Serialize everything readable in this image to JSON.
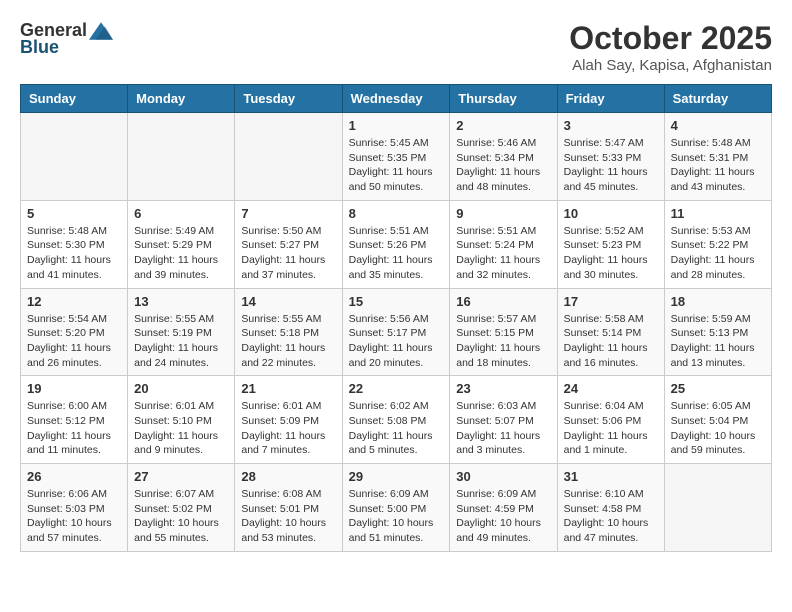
{
  "logo": {
    "general": "General",
    "blue": "Blue"
  },
  "title": "October 2025",
  "subtitle": "Alah Say, Kapisa, Afghanistan",
  "days_of_week": [
    "Sunday",
    "Monday",
    "Tuesday",
    "Wednesday",
    "Thursday",
    "Friday",
    "Saturday"
  ],
  "weeks": [
    [
      {
        "day": "",
        "sunrise": "",
        "sunset": "",
        "daylight": ""
      },
      {
        "day": "",
        "sunrise": "",
        "sunset": "",
        "daylight": ""
      },
      {
        "day": "",
        "sunrise": "",
        "sunset": "",
        "daylight": ""
      },
      {
        "day": "1",
        "sunrise": "Sunrise: 5:45 AM",
        "sunset": "Sunset: 5:35 PM",
        "daylight": "Daylight: 11 hours and 50 minutes."
      },
      {
        "day": "2",
        "sunrise": "Sunrise: 5:46 AM",
        "sunset": "Sunset: 5:34 PM",
        "daylight": "Daylight: 11 hours and 48 minutes."
      },
      {
        "day": "3",
        "sunrise": "Sunrise: 5:47 AM",
        "sunset": "Sunset: 5:33 PM",
        "daylight": "Daylight: 11 hours and 45 minutes."
      },
      {
        "day": "4",
        "sunrise": "Sunrise: 5:48 AM",
        "sunset": "Sunset: 5:31 PM",
        "daylight": "Daylight: 11 hours and 43 minutes."
      }
    ],
    [
      {
        "day": "5",
        "sunrise": "Sunrise: 5:48 AM",
        "sunset": "Sunset: 5:30 PM",
        "daylight": "Daylight: 11 hours and 41 minutes."
      },
      {
        "day": "6",
        "sunrise": "Sunrise: 5:49 AM",
        "sunset": "Sunset: 5:29 PM",
        "daylight": "Daylight: 11 hours and 39 minutes."
      },
      {
        "day": "7",
        "sunrise": "Sunrise: 5:50 AM",
        "sunset": "Sunset: 5:27 PM",
        "daylight": "Daylight: 11 hours and 37 minutes."
      },
      {
        "day": "8",
        "sunrise": "Sunrise: 5:51 AM",
        "sunset": "Sunset: 5:26 PM",
        "daylight": "Daylight: 11 hours and 35 minutes."
      },
      {
        "day": "9",
        "sunrise": "Sunrise: 5:51 AM",
        "sunset": "Sunset: 5:24 PM",
        "daylight": "Daylight: 11 hours and 32 minutes."
      },
      {
        "day": "10",
        "sunrise": "Sunrise: 5:52 AM",
        "sunset": "Sunset: 5:23 PM",
        "daylight": "Daylight: 11 hours and 30 minutes."
      },
      {
        "day": "11",
        "sunrise": "Sunrise: 5:53 AM",
        "sunset": "Sunset: 5:22 PM",
        "daylight": "Daylight: 11 hours and 28 minutes."
      }
    ],
    [
      {
        "day": "12",
        "sunrise": "Sunrise: 5:54 AM",
        "sunset": "Sunset: 5:20 PM",
        "daylight": "Daylight: 11 hours and 26 minutes."
      },
      {
        "day": "13",
        "sunrise": "Sunrise: 5:55 AM",
        "sunset": "Sunset: 5:19 PM",
        "daylight": "Daylight: 11 hours and 24 minutes."
      },
      {
        "day": "14",
        "sunrise": "Sunrise: 5:55 AM",
        "sunset": "Sunset: 5:18 PM",
        "daylight": "Daylight: 11 hours and 22 minutes."
      },
      {
        "day": "15",
        "sunrise": "Sunrise: 5:56 AM",
        "sunset": "Sunset: 5:17 PM",
        "daylight": "Daylight: 11 hours and 20 minutes."
      },
      {
        "day": "16",
        "sunrise": "Sunrise: 5:57 AM",
        "sunset": "Sunset: 5:15 PM",
        "daylight": "Daylight: 11 hours and 18 minutes."
      },
      {
        "day": "17",
        "sunrise": "Sunrise: 5:58 AM",
        "sunset": "Sunset: 5:14 PM",
        "daylight": "Daylight: 11 hours and 16 minutes."
      },
      {
        "day": "18",
        "sunrise": "Sunrise: 5:59 AM",
        "sunset": "Sunset: 5:13 PM",
        "daylight": "Daylight: 11 hours and 13 minutes."
      }
    ],
    [
      {
        "day": "19",
        "sunrise": "Sunrise: 6:00 AM",
        "sunset": "Sunset: 5:12 PM",
        "daylight": "Daylight: 11 hours and 11 minutes."
      },
      {
        "day": "20",
        "sunrise": "Sunrise: 6:01 AM",
        "sunset": "Sunset: 5:10 PM",
        "daylight": "Daylight: 11 hours and 9 minutes."
      },
      {
        "day": "21",
        "sunrise": "Sunrise: 6:01 AM",
        "sunset": "Sunset: 5:09 PM",
        "daylight": "Daylight: 11 hours and 7 minutes."
      },
      {
        "day": "22",
        "sunrise": "Sunrise: 6:02 AM",
        "sunset": "Sunset: 5:08 PM",
        "daylight": "Daylight: 11 hours and 5 minutes."
      },
      {
        "day": "23",
        "sunrise": "Sunrise: 6:03 AM",
        "sunset": "Sunset: 5:07 PM",
        "daylight": "Daylight: 11 hours and 3 minutes."
      },
      {
        "day": "24",
        "sunrise": "Sunrise: 6:04 AM",
        "sunset": "Sunset: 5:06 PM",
        "daylight": "Daylight: 11 hours and 1 minute."
      },
      {
        "day": "25",
        "sunrise": "Sunrise: 6:05 AM",
        "sunset": "Sunset: 5:04 PM",
        "daylight": "Daylight: 10 hours and 59 minutes."
      }
    ],
    [
      {
        "day": "26",
        "sunrise": "Sunrise: 6:06 AM",
        "sunset": "Sunset: 5:03 PM",
        "daylight": "Daylight: 10 hours and 57 minutes."
      },
      {
        "day": "27",
        "sunrise": "Sunrise: 6:07 AM",
        "sunset": "Sunset: 5:02 PM",
        "daylight": "Daylight: 10 hours and 55 minutes."
      },
      {
        "day": "28",
        "sunrise": "Sunrise: 6:08 AM",
        "sunset": "Sunset: 5:01 PM",
        "daylight": "Daylight: 10 hours and 53 minutes."
      },
      {
        "day": "29",
        "sunrise": "Sunrise: 6:09 AM",
        "sunset": "Sunset: 5:00 PM",
        "daylight": "Daylight: 10 hours and 51 minutes."
      },
      {
        "day": "30",
        "sunrise": "Sunrise: 6:09 AM",
        "sunset": "Sunset: 4:59 PM",
        "daylight": "Daylight: 10 hours and 49 minutes."
      },
      {
        "day": "31",
        "sunrise": "Sunrise: 6:10 AM",
        "sunset": "Sunset: 4:58 PM",
        "daylight": "Daylight: 10 hours and 47 minutes."
      },
      {
        "day": "",
        "sunrise": "",
        "sunset": "",
        "daylight": ""
      }
    ]
  ]
}
